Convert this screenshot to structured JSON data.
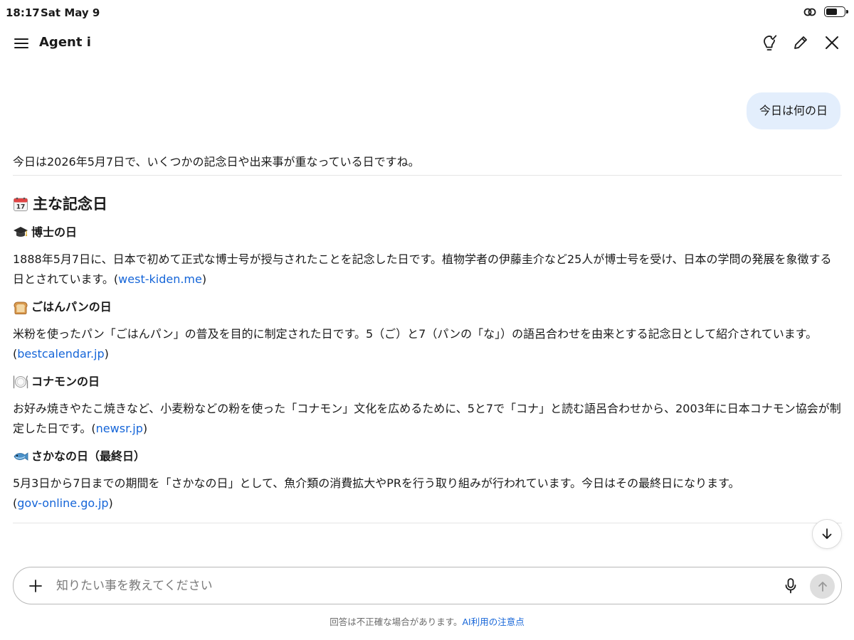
{
  "status_bar": {
    "time": "18:17",
    "date": "Sat May 9"
  },
  "header": {
    "title": "Agent i"
  },
  "conversation": {
    "user_message": "今日は何の日",
    "intro": "今日は2026年5月7日で、いくつかの記念日や出来事が重なっている日ですね。",
    "section_title": "主な記念日",
    "items": [
      {
        "title": "博士の日",
        "body": "1888年5月7日に、日本で初めて正式な博士号が授与されたことを記念した日です。植物学者の伊藤圭介など25人が博士号を受け、日本の学問の発展を象徴する日とされています。",
        "source": "west-kiden.me"
      },
      {
        "title": "ごはんパンの日",
        "body": "米粉を使ったパン「ごはんパン」の普及を目的に制定された日です。5（ご）と7（パンの「な」）の語呂合わせを由来とする記念日として紹介されています。",
        "source": "bestcalendar.jp"
      },
      {
        "title": "コナモンの日",
        "body": "お好み焼きやたこ焼きなど、小麦粉などの粉を使った「コナモン」文化を広めるために、5と7で「コナ」と読む語呂合わせから、2003年に日本コナモン協会が制定した日です。",
        "source": "newsr.jp"
      },
      {
        "title": "さかなの日（最終日）",
        "body": "5月3日から7日までの期間を「さかなの日」として、魚介類の消費拡大やPRを行う取り組みが行われています。今日はその最終日になります。",
        "source": "gov-online.go.jp"
      }
    ]
  },
  "composer": {
    "placeholder": "知りたい事を教えてください"
  },
  "footer": {
    "disclaimer": "回答は不正確な場合があります。",
    "link": "AI利用の注意点"
  },
  "colors": {
    "accent": "#1565d8",
    "user_bubble": "#e3eefc"
  },
  "icons": {
    "menu": "hamburger-icon",
    "bulb": "lightbulb-check-icon",
    "edit": "pencil-icon",
    "close": "close-icon",
    "calendar": "calendar-emoji",
    "grad": "graduation-cap-emoji",
    "bread": "bread-emoji",
    "plate": "plate-cutlery-emoji",
    "fish": "fish-emoji",
    "plus": "plus-icon",
    "mic": "microphone-icon",
    "send": "arrow-up-icon",
    "down": "arrow-down-icon"
  }
}
